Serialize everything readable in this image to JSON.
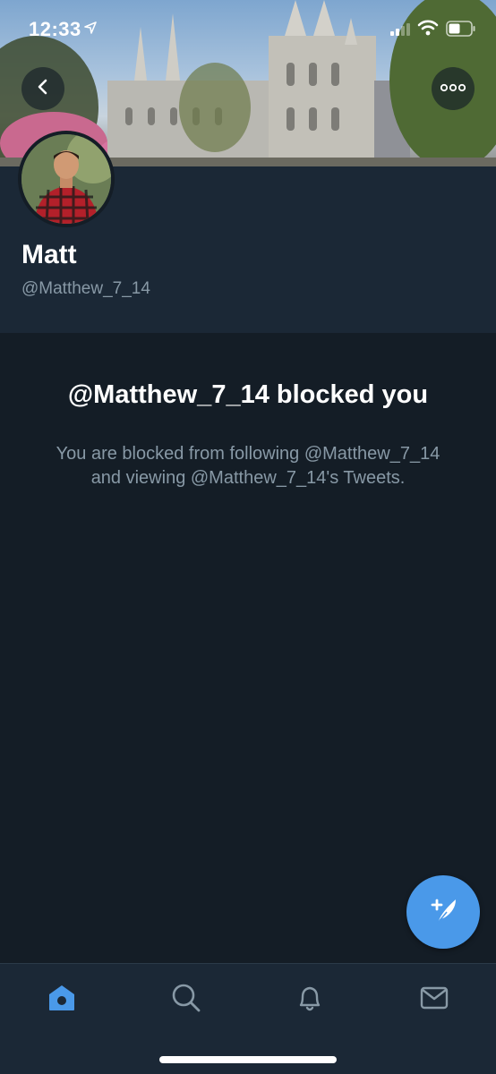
{
  "status_bar": {
    "time": "12:33"
  },
  "profile": {
    "name": "Matt",
    "handle": "@Matthew_7_14"
  },
  "blocked": {
    "title": "@Matthew_7_14 blocked you",
    "body": "You are blocked from following @Matthew_7_14 and viewing @Matthew_7_14's Tweets."
  },
  "tab_bar": {
    "items": [
      {
        "icon": "home-icon",
        "active": true
      },
      {
        "icon": "search-icon",
        "active": false
      },
      {
        "icon": "notifications-icon",
        "active": false
      },
      {
        "icon": "messages-icon",
        "active": false
      }
    ]
  },
  "colors": {
    "accent": "#4a99e9",
    "background": "#141d26",
    "card": "#1b2836",
    "muted_text": "#8899a6"
  }
}
